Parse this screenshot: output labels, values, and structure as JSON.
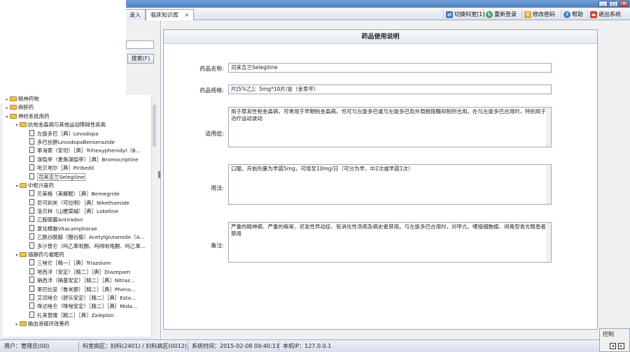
{
  "window": {
    "title": "临床知识库",
    "min": "_",
    "max": "□",
    "close": "×"
  },
  "tabs": [
    {
      "label": "录入"
    },
    {
      "label": "临床知识库",
      "close": "×"
    }
  ],
  "toolbar": {
    "switch_dept": "切换科室[1]",
    "relogin": "重新登录",
    "change_password": "修改密码",
    "help": "帮助",
    "exit": "退出系统"
  },
  "left": {
    "search_button": "搜索(F)",
    "tree": [
      {
        "level": 0,
        "type": "folder",
        "exp": "▸",
        "label": "精神药物"
      },
      {
        "level": 0,
        "type": "folder",
        "exp": "▸",
        "label": "麻醉药"
      },
      {
        "level": 0,
        "type": "folder",
        "exp": "▾",
        "label": "神经系统用药"
      },
      {
        "level": 1,
        "type": "folder",
        "exp": "▾",
        "label": "抗帕金森病与其他运动障碍性疾病"
      },
      {
        "level": 2,
        "type": "file",
        "label": "左旋多巴［典］Levodopa"
      },
      {
        "level": 2,
        "type": "file",
        "label": "多巴丝肼LevodopaBenserazide"
      },
      {
        "level": 2,
        "type": "file",
        "label": "苯海索（安坦）［典］Trihexyphenidyl（B..."
      },
      {
        "level": 2,
        "type": "file",
        "label": "溴隐亭（麦角溴隐亭）［典］Bromocriptine"
      },
      {
        "level": 2,
        "type": "file",
        "label": "吡贝地尔［典］Piribedil"
      },
      {
        "level": 2,
        "type": "file",
        "label": "司来吉兰Selegiline",
        "selected": true
      },
      {
        "level": 1,
        "type": "folder",
        "exp": "▾",
        "label": "中枢兴奋药"
      },
      {
        "level": 2,
        "type": "file",
        "label": "贝美格（美解眠）［典］Bemegride"
      },
      {
        "level": 2,
        "type": "file",
        "label": "尼可刹米（可拉明）［典］Nikethamide"
      },
      {
        "level": 2,
        "type": "file",
        "label": "洛贝林（山梗菜碱）［典］Lobeline"
      },
      {
        "level": 2,
        "type": "file",
        "label": "乙胺硫脲Antiradon"
      },
      {
        "level": 2,
        "type": "file",
        "label": "氯化樟脑Vitacamphorae"
      },
      {
        "level": 2,
        "type": "file",
        "label": "乙酰谷酰胺（醋谷胺）Acetylglutamide（A..."
      },
      {
        "level": 2,
        "type": "file",
        "label": "多沙普仑（吗乙苯吡酮、吗啡吡咯酮、吗乙苯..."
      },
      {
        "level": 1,
        "type": "folder",
        "exp": "▾",
        "label": "镇静药与催眠药"
      },
      {
        "level": 2,
        "type": "file",
        "label": "三唑仑［精一］［典］Triazolam"
      },
      {
        "level": 2,
        "type": "file",
        "label": "地西泮（安定）［精二］［典］Diazepam"
      },
      {
        "level": 2,
        "type": "file",
        "label": "硝西泮（硝基安定）［精二］［典］Nitraz..."
      },
      {
        "level": 2,
        "type": "file",
        "label": "苯巴比妥（鲁米那）［精二］［典］Pheno..."
      },
      {
        "level": 2,
        "type": "file",
        "label": "艾司唑仑（舒乐安定）［精二］［典］Esta..."
      },
      {
        "level": 2,
        "type": "file",
        "label": "咪达唑仑（咪唑安定）［精二］［典］Mida..."
      },
      {
        "level": 2,
        "type": "file",
        "label": "扎来普隆［精二］［典］Zaleplon"
      },
      {
        "level": 1,
        "type": "folder",
        "exp": "▸",
        "label": "脑血液循环改善药"
      }
    ]
  },
  "doc": {
    "title": "药品使用说明",
    "name_label": "药品名称:",
    "name_value": "司来吉兰Selegiline",
    "spec_label": "药品规格:",
    "spec_value": "片[5%乙]：5mg*10片/盒（金思平）",
    "indication_label": "适用症:",
    "indication_value": "用于原发性帕金森病，可单用于早期帕金森病，也可与左旋多巴或与左旋多巴及外周脱羧酶抑制剂合用。在与左旋多巴合用时，特别用于治疗运动波动",
    "usage_label": "用法:",
    "usage_value": "口服。开始剂量为早晨5mg，可增至10mg/日（可分为早、中2次或早晨1次）",
    "notes_label": "备注:",
    "notes_value": "严重的精神病、严重的痴呆、迟发性异动症、有消化性溃疡及病史者禁用。与左旋多巴合用时，对甲亢、嗜铬细胞瘤、闭角型青光眼患者禁用"
  },
  "control": {
    "title": "控制",
    "btn1": "◂",
    "btn2": "▸"
  },
  "status": {
    "user": "用户：管理员(00)",
    "ward": "科室病区：妇科(2401) / 妇科病区(0012)",
    "time": "系统时间：2015-02-08 09:40:13",
    "ip": "本机IP：127.0.0.1"
  }
}
